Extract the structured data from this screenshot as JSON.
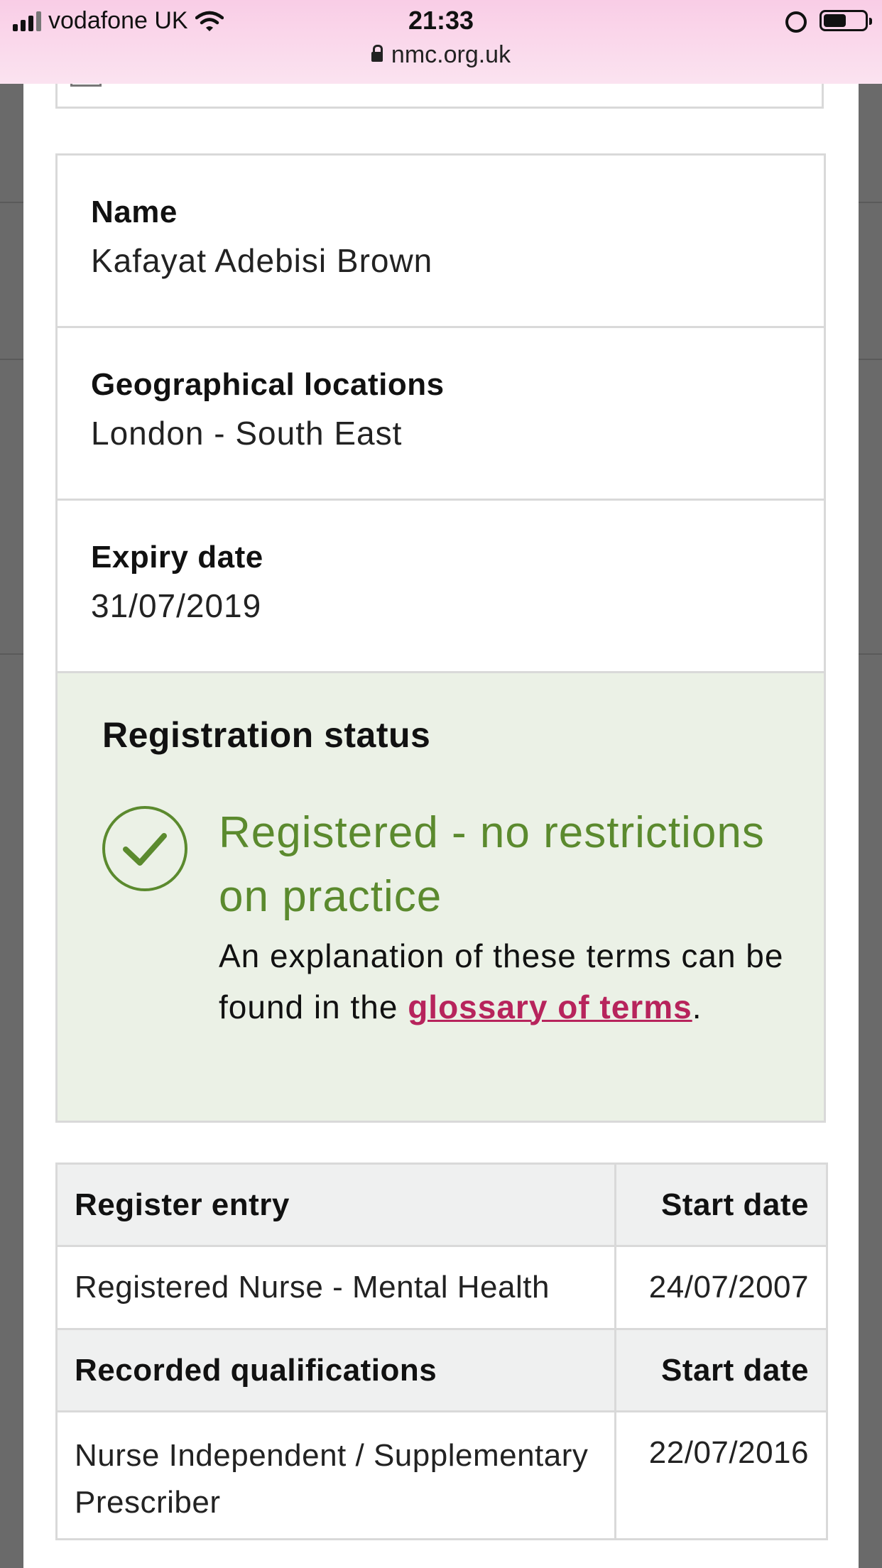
{
  "status_bar": {
    "carrier": "vodafone UK",
    "time": "21:33",
    "url": "nmc.org.uk",
    "battery_level": 0.56
  },
  "details": {
    "name_label": "Name",
    "name_value": "Kafayat Adebisi Brown",
    "location_label": "Geographical locations",
    "location_value": "London - South East",
    "expiry_label": "Expiry date",
    "expiry_value": "31/07/2019"
  },
  "registration": {
    "title": "Registration status",
    "status": "Registered - no restrictions on practice",
    "explain_prefix": "An explanation of these terms can be found in the ",
    "glossary_link": "glossary of terms",
    "explain_suffix": ".",
    "status_color": "#5b8a2e",
    "link_color": "#b7245c",
    "panel_color": "#ebf1e6"
  },
  "entries": {
    "register_header": "Register entry",
    "register_date_header": "Start date",
    "register_rows": [
      {
        "entry": "Registered Nurse - Mental Health",
        "start_date": "24/07/2007"
      }
    ],
    "qualifications_header": "Recorded qualifications",
    "qualifications_date_header": "Start date",
    "qualification_rows": [
      {
        "entry": "Nurse Independent / Supplementary Prescriber",
        "start_date": "22/07/2016"
      }
    ]
  },
  "icons": {
    "status_icon": "check-circle-icon",
    "lock": "lock-icon",
    "wifi": "wifi-icon",
    "alarm": "alarm-icon",
    "battery": "battery-icon"
  }
}
